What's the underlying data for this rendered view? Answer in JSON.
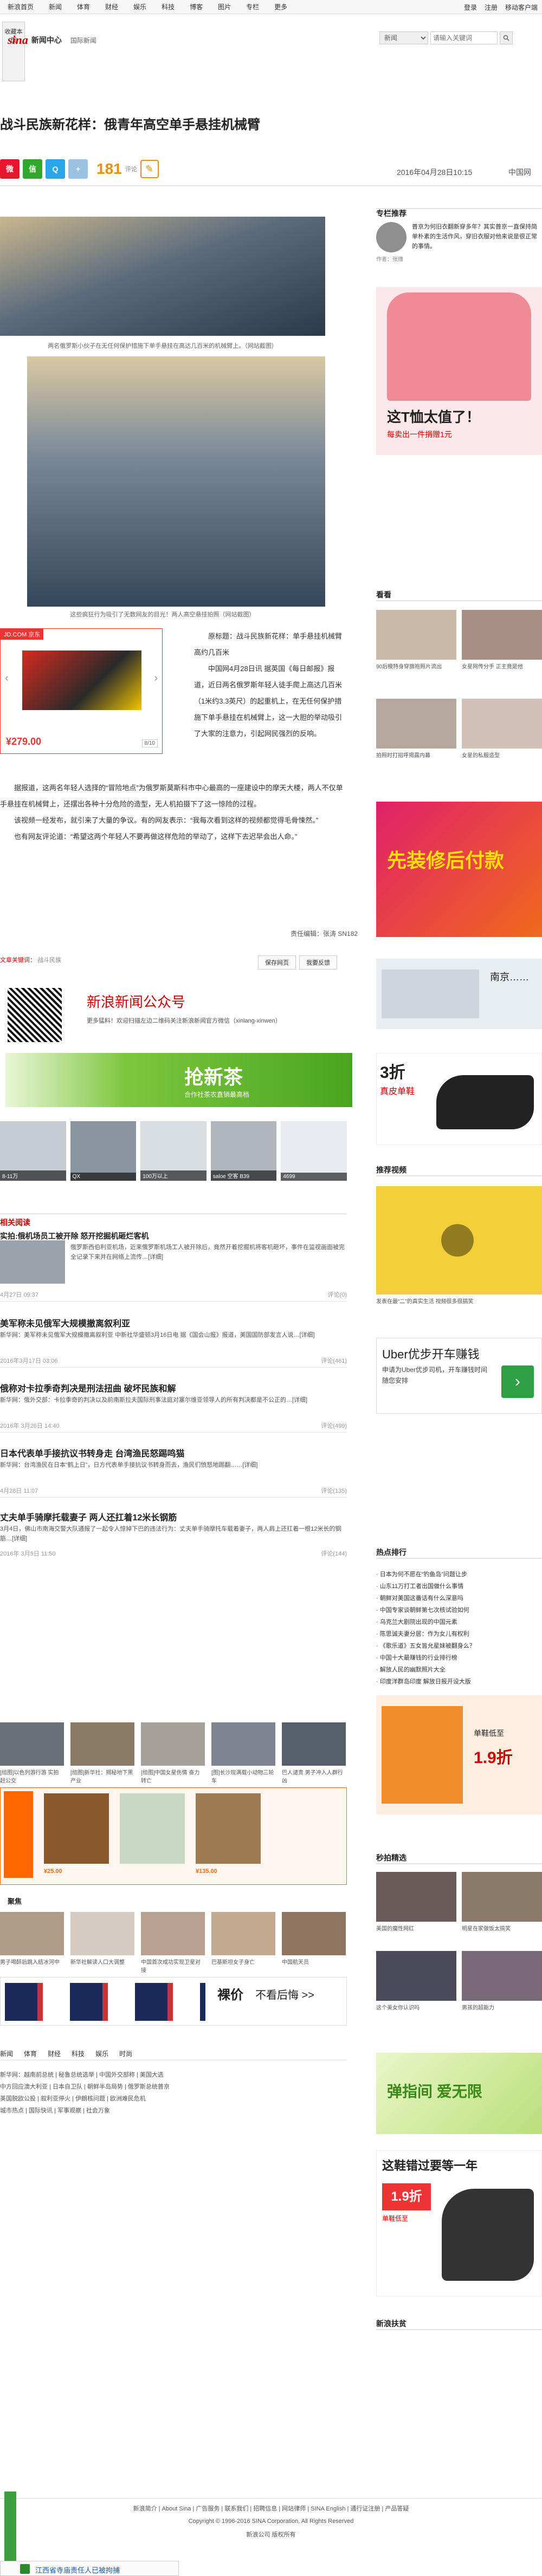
{
  "topbar": {
    "nav": [
      "新浪首页",
      "新闻",
      "体育",
      "财经",
      "娱乐",
      "科技",
      "博客",
      "图片",
      "专栏",
      "更多"
    ],
    "right": [
      "登录",
      "注册",
      "移动客户端"
    ]
  },
  "fav": {
    "label": "收藏本页"
  },
  "brand": {
    "logo": "sina",
    "name": "新闻中心",
    "section": "国际新闻"
  },
  "search": {
    "scope": "新闻",
    "placeholder": "请输入关键词"
  },
  "article": {
    "title": "战斗民族新花样：俄青年高空单手悬挂机械臂",
    "comments": "181",
    "comments_label": "评论",
    "date": "2016年04月28日10:15",
    "source": "中国网",
    "caption1": "两名俄罗斯小伙子在无任何保护措施下单手悬挂在高达几百米的机械臂上。（网站截图）",
    "caption2": "这些疯狂行为吸引了无数网友的目光！两人高空悬挂拍照（网站截图）",
    "p1": "原标题：战斗民族新花样：单手悬挂机械臂 高约几百米",
    "p2": "中国网4月28日讯 据英国《每日邮报》报道，近日两名俄罗斯年轻人徒手爬上高达几百米（1米约3.3英尺）的起重机上，在无任何保护措施下单手悬挂在机械臂上，这一大胆的举动吸引了大家的注意力，引起网民强烈的反响。",
    "p3": "据报道，这两名年轻人选择的“冒险地点”为俄罗斯莫斯科市中心最高的一座建设中的摩天大楼，两人不仅单手悬挂在机械臂上，还摆出各种十分危险的造型，无人机拍摄下了这一惊险的过程。",
    "p4": "该视频一经发布，就引来了大量的争议。有的网友表示：“我每次看到这样的视频都觉得毛骨悚然。”",
    "p5": "也有网友评论道：“希望这两个年轻人不要再做这样危险的举动了，这样下去迟早会出人命。”",
    "editor": "责任编辑：张涛 SN182",
    "tags_label": "文章关键词：",
    "tags": "战斗民族",
    "action_fav": "保存网页",
    "action_err": "我要反馈"
  },
  "ad_shoe": {
    "brand": "JD.COM 京东",
    "price": "¥279.00",
    "page": "8/10"
  },
  "wechat": {
    "title": "新浪新闻公众号",
    "sub": "更多猛料！欢迎扫描左边二维码关注新浪新闻官方微信（xinlang-xinwen）"
  },
  "tea": {
    "title": "抢新茶",
    "sub": "合作社茶农直销最高档"
  },
  "cars": [
    {
      "label": "8-11万"
    },
    {
      "label": "QX"
    },
    {
      "label": "100万以上"
    },
    {
      "label": "saloe 空客 B39"
    },
    {
      "label": "4699"
    }
  ],
  "related": {
    "header": "相关阅读",
    "items": [
      {
        "title": "实拍:俄机场员工被开除 怒开挖掘机砸烂客机",
        "desc": "俄罗斯西伯利亚机场，近来俄罗斯机场工人被开除后，竟然开着挖掘机将客机砸坏，事件在监视画面被完全记录下来并在网络上流传…[详细]",
        "meta": "俄罗斯 战斗民族 飞机",
        "date": "4月27日 09:37",
        "r": "评论(0)"
      },
      {
        "title": "美军称未见俄军大规模撤离叙利亚",
        "desc": "新华网：美军称未见俄军大规模撤离叙利亚 中新社华盛顿3月16日电 据《国会山报》报道，美国国防部发言人说…[详细]",
        "meta": "",
        "date": "2016年3月17日 03:06",
        "r": "评论(461)"
      },
      {
        "title": "俄称对卡拉季奇判决是刑法扭曲 破坏民族和解",
        "desc": "新华网：俄外交部：卡拉季奇的判决以及前南斯拉夫国际刑事法庭对塞尔维亚领导人的所有判决都是不公正的…[详细]",
        "meta": "",
        "date": "2016年 3月26日 14:40",
        "r": "评论(499)"
      },
      {
        "title": "日本代表单手接抗议书转身走 台湾渔民怒踢鸣猫",
        "desc": "新华网：台湾渔民在日本“鹤上日”，日方代表单手接抗议书转身而去，渔民们愤怒地踢翻……[详细]",
        "meta": "",
        "date": "4月28日 11:07",
        "r": "评论(135)"
      },
      {
        "title": "丈夫单手骑摩托载妻子 两人还扛着12米长钢筋",
        "desc": "3月4日，佛山市南海交警大队通报了一起令人惊掉下巴的违法行为：丈夫单手骑摩托车载着妻子，两人肩上还扛着一根12米长的钢筋…[详细]",
        "meta": "",
        "date": "2016年 3月5日 11:50",
        "r": "评论(144)"
      }
    ]
  },
  "mid_thumbs": [
    "[组图]以色列游行游 实拍赶公交",
    "[组图]新华社：揭秘地下黑产业",
    "[组图]中国女星伤情 奋力转亡",
    "[图]长沙现满载小动物三轮车",
    "巴人谴责 男子冲入人群行凶"
  ],
  "taobao": {
    "price1": "¥25.00",
    "price2": "¥135.00"
  },
  "group2_header": "聚焦",
  "group2_thumbs": [
    "男子喝醉后跳入结冰河中",
    "新华社解读人口大调整",
    "中国首次成功实现卫星对接",
    "巴基斯坦女子身亡",
    "中国航天员"
  ],
  "ad_ghost": {
    "text": "裸价",
    "sub": "不看后悔 >>"
  },
  "linkgrid": {
    "header": [
      "新闻",
      "体育",
      "财经",
      "科技",
      "娱乐",
      "时尚"
    ],
    "rows": [
      "新华网：越南前总统 | 秘鲁总统选举 | 中国外交部称 | 美国大选",
      "中方回应澳大利亚 | 日本自卫队 | 朝鲜半岛局势 | 俄罗斯总统普京",
      "英国脱欧公投 | 叙利亚停火 | 伊朗核问题 | 欧洲难民危机",
      "城市热点 | 国际快讯 | 军事观察 | 社会万象"
    ]
  },
  "sidebar": {
    "rec_header": "专栏推荐",
    "rec_text": "普京为何旧衣翻新穿多年？其实普京一直保持简单朴素的生活作风，穿旧衣服对他来说是很正常的事情。",
    "rec_author": "作者：张维",
    "banner1_text": "这T恤太值了！",
    "banner1_sub": "每卖出一件捐赠1元",
    "kan_header": "看看",
    "kan": [
      "90后模特身穿旗袍照片流出",
      "女星网传分手 正主竟是他",
      "拍照时打招呼揭露内幕",
      "女星的私服造型"
    ],
    "banner2_text": "先装修后付款",
    "car_ad": "南京……",
    "shoes_text": "3折",
    "shoes_sub": "真皮单鞋",
    "video_header": "推荐视频",
    "video_cap": "发表在最“二”的真实生活 视频很多很搞笑",
    "uber_text": "Uber优步开车赚钱",
    "uber_sub": "申请为Uber优步司机，开车赚钱时间随您安排",
    "hot_header": "热点排行",
    "hot": [
      "日本为何不愿在“钓鱼岛”问题让步",
      "山东11万打工者出国做什么事情",
      "朝鲜对美国这番话有什么深意吗",
      "中国专家谈朝鲜第七次核试验如何",
      "乌克兰大剧院出现的中国元素",
      "陈思诚夫妻分居：作为女儿有权利",
      "《歌乐道》五女皆允星妹被翻身么？",
      "中国十大最赚钱的行业排行榜",
      "解放人民的幽默照片大全",
      "印度洋群岛印度 解放日报开设大版"
    ],
    "mobile_ad_text": "单鞋低至",
    "mobile_ad_price": "1.9折",
    "second_header": "秒拍精选",
    "second": [
      "美国的魔性网红",
      "明星在家做饭太搞笑",
      "这个美女你认识吗",
      "男孩的超能力"
    ],
    "green_banner": "弹指间 爱无限",
    "shoes2_text": "这鞋错过要等一年",
    "shoes2_price": "1.9折",
    "shoes2_sub": "单鞋低至",
    "last_header": "新浪扶贫"
  },
  "footer": {
    "links": "新浪简介 | About Sina | 广告服务 | 联系我们 | 招聘信息 | 网站律师 | SINA English | 通行证注册 | 产品答疑",
    "copy": "Copyright © 1996-2016 SINA Corporation, All Rights Reserved",
    "lic": "新浪公司 版权所有"
  },
  "bottombar": {
    "text": "江西省寺庙责任人已被拘捕"
  }
}
